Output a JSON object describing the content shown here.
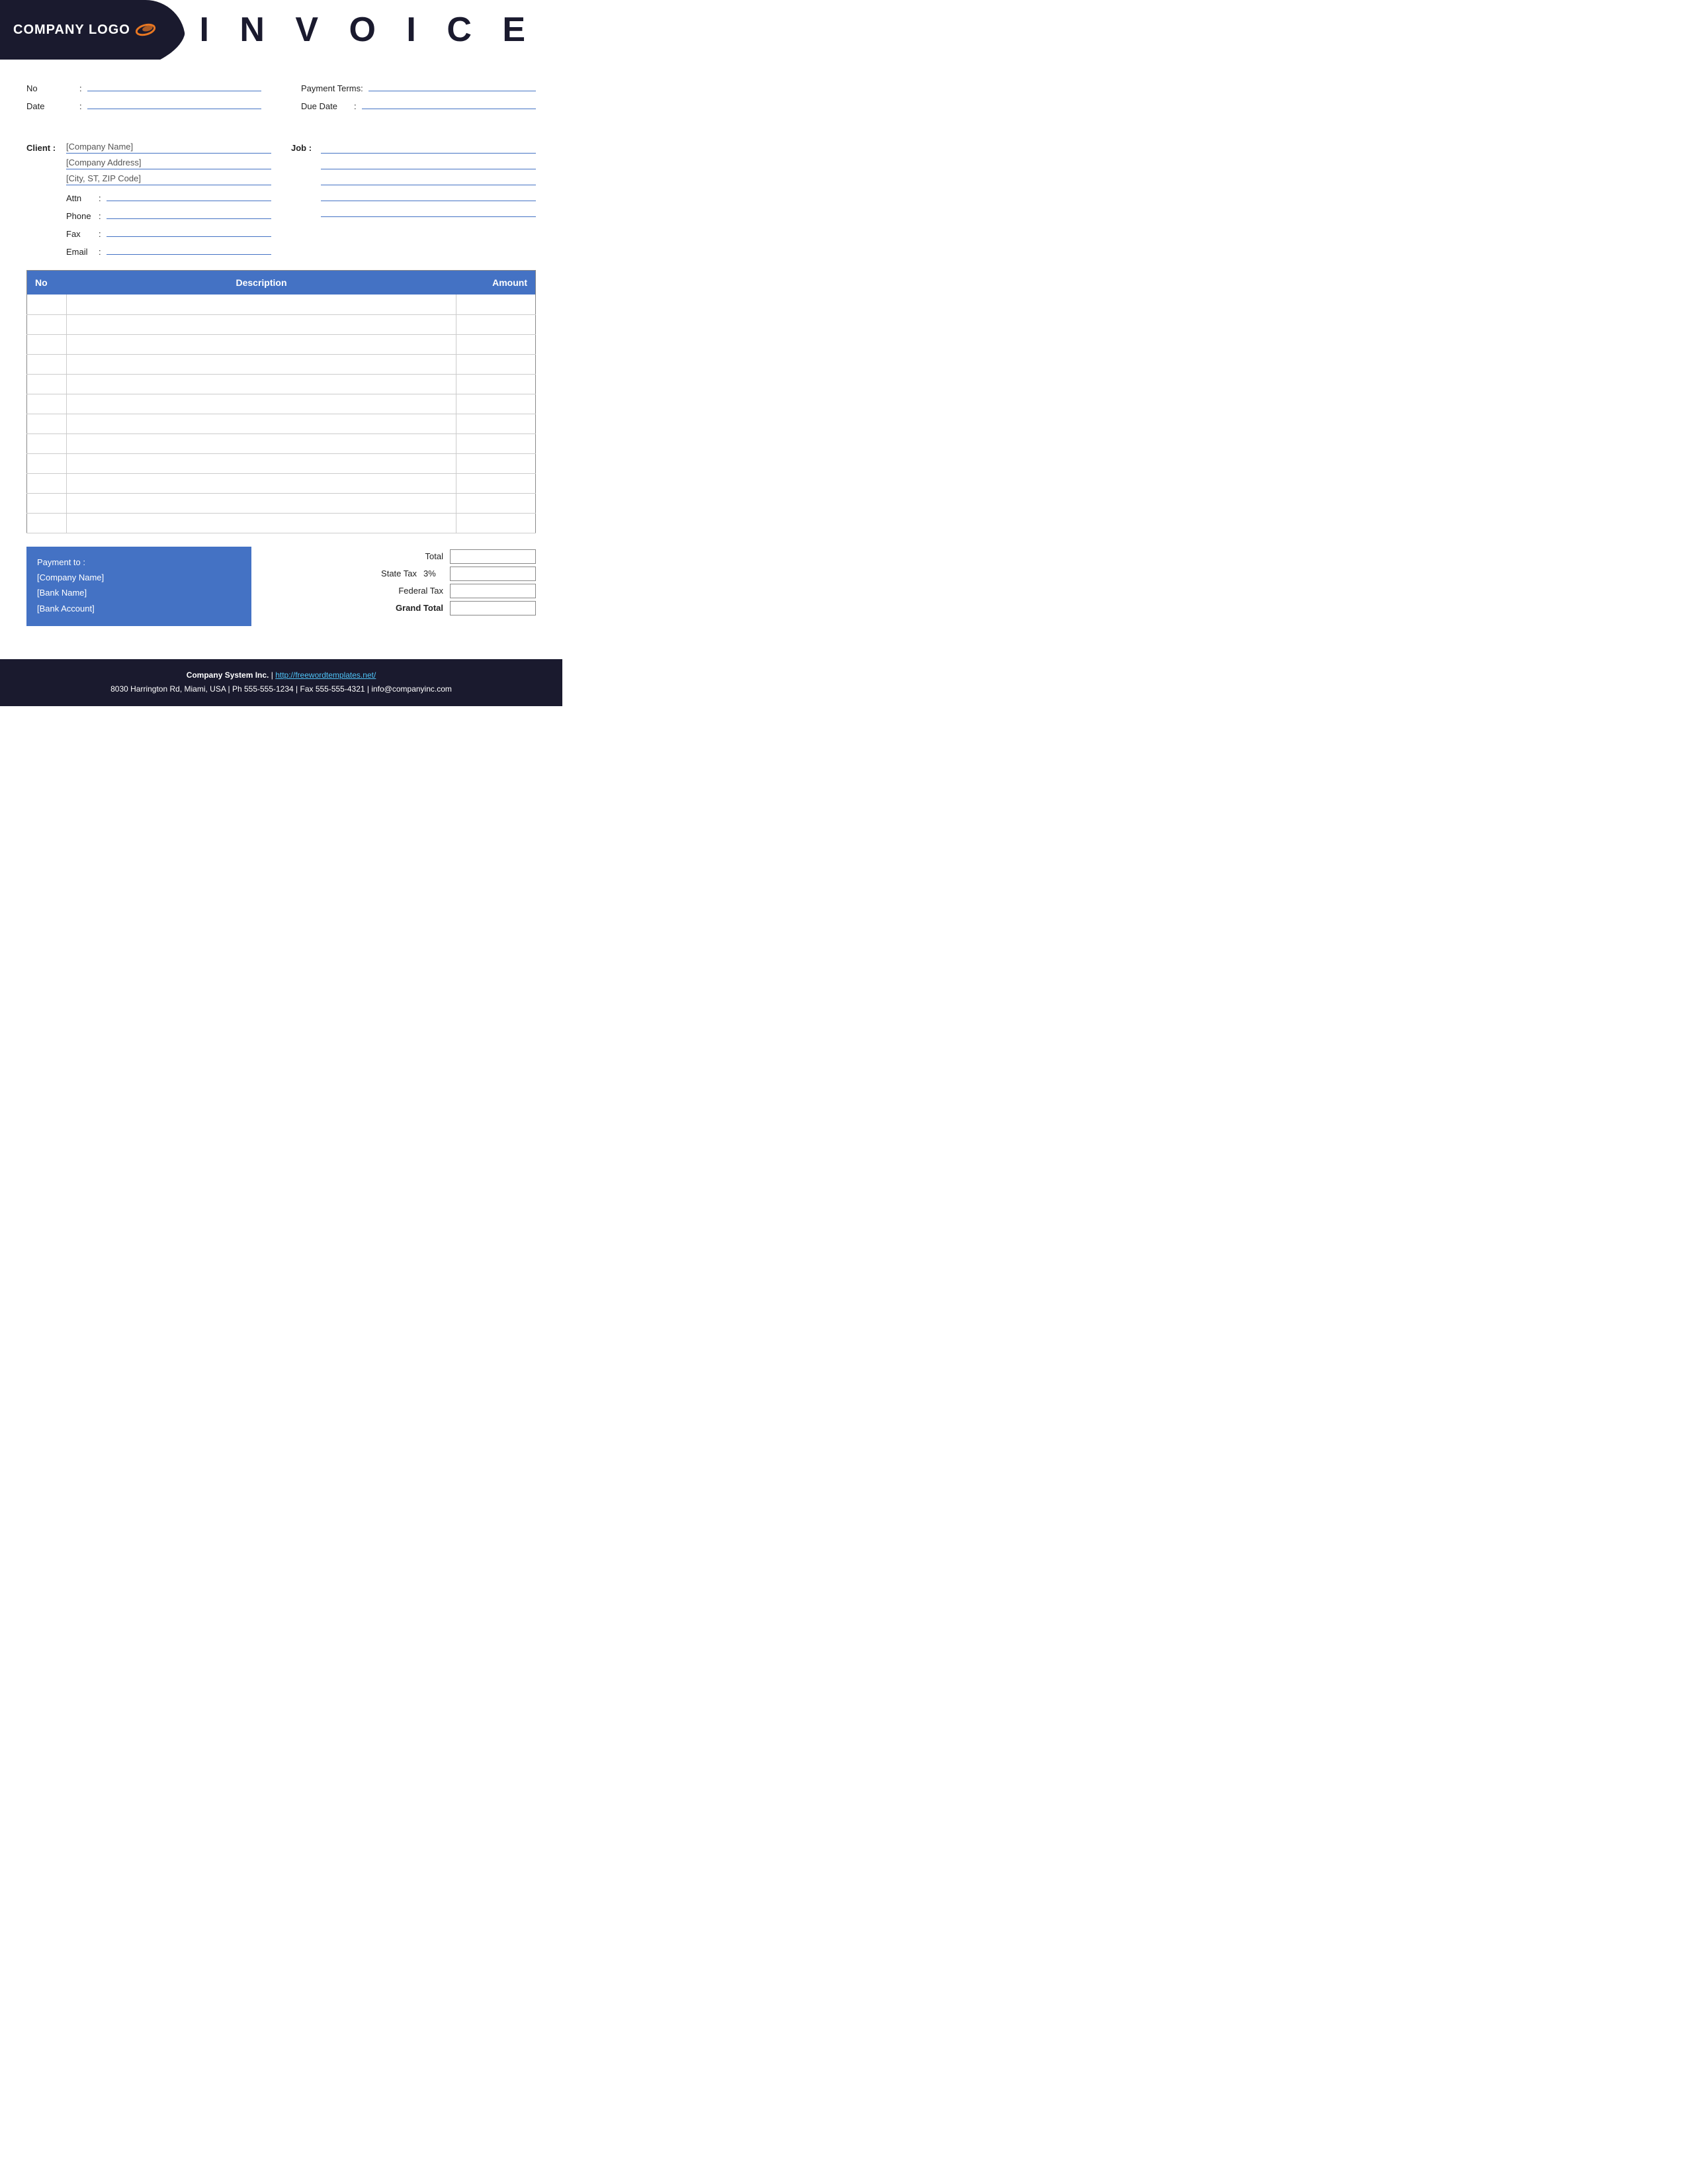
{
  "header": {
    "logo_text": "COMPANY LOGO",
    "invoice_title": "I N V O I C E"
  },
  "form": {
    "no_label": "No",
    "no_colon": ":",
    "date_label": "Date",
    "date_colon": ":",
    "payment_terms_label": "Payment  Terms",
    "payment_terms_colon": ":",
    "due_date_label": "Due Date",
    "due_date_colon": ":"
  },
  "client": {
    "label": "Client :",
    "company_name": "[Company Name]",
    "company_address": "[Company Address]",
    "city": "[City, ST, ZIP Code]",
    "attn_label": "Attn",
    "attn_colon": ":",
    "phone_label": "Phone",
    "phone_colon": ":",
    "fax_label": "Fax",
    "fax_colon": ":",
    "email_label": "Email",
    "email_colon": ":"
  },
  "job": {
    "label": "Job :"
  },
  "table": {
    "col_no": "No",
    "col_description": "Description",
    "col_amount": "Amount",
    "rows": [
      {
        "no": "",
        "description": "",
        "amount": ""
      },
      {
        "no": "",
        "description": "",
        "amount": ""
      },
      {
        "no": "",
        "description": "",
        "amount": ""
      },
      {
        "no": "",
        "description": "",
        "amount": ""
      },
      {
        "no": "",
        "description": "",
        "amount": ""
      },
      {
        "no": "",
        "description": "",
        "amount": ""
      },
      {
        "no": "",
        "description": "",
        "amount": ""
      },
      {
        "no": "",
        "description": "",
        "amount": ""
      },
      {
        "no": "",
        "description": "",
        "amount": ""
      },
      {
        "no": "",
        "description": "",
        "amount": ""
      },
      {
        "no": "",
        "description": "",
        "amount": ""
      },
      {
        "no": "",
        "description": "",
        "amount": ""
      }
    ]
  },
  "payment": {
    "title": "Payment to :",
    "company_name": "[Company Name]",
    "bank_name": "[Bank Name]",
    "bank_account": "[Bank Account]"
  },
  "totals": {
    "total_label": "Total",
    "state_tax_label": "State Tax",
    "state_tax_pct": "3%",
    "federal_tax_label": "Federal Tax",
    "grand_total_label": "Grand Total"
  },
  "footer": {
    "company_bold": "Company System Inc.",
    "separator": "|",
    "website": "http://freewordtemplates.net/",
    "address_line": "8030 Harrington Rd, Miami, USA | Ph 555-555-1234 | Fax 555-555-4321 | info@companyinc.com"
  }
}
